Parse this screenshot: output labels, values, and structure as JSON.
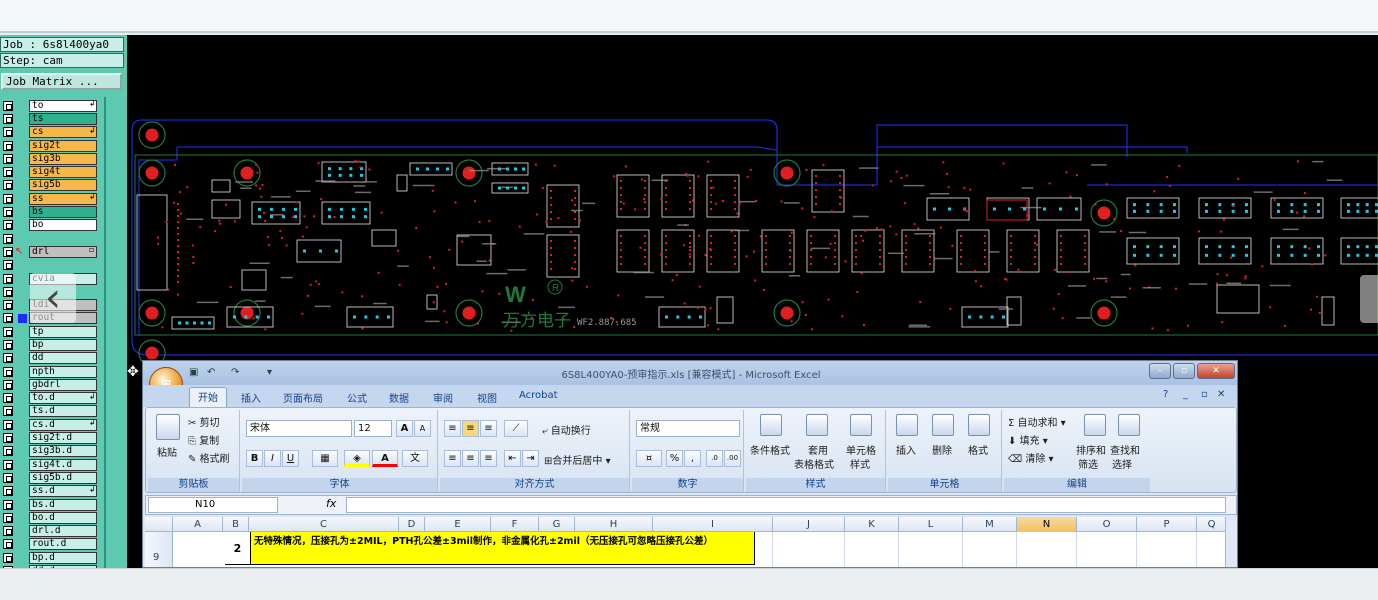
{
  "genesis": {
    "job_line": "Job : 6s8l400ya0",
    "step_line": "Step: cam",
    "job_matrix_btn": "Job Matrix ...",
    "layers": [
      {
        "name": "to",
        "color": "#ffffff",
        "arrow": "↲"
      },
      {
        "name": "ts",
        "color": "#2fb08e",
        "arrow": ""
      },
      {
        "name": "cs",
        "color": "#f6b84a",
        "arrow": "↲"
      },
      {
        "name": "sig2t",
        "color": "#f6b84a",
        "arrow": ""
      },
      {
        "name": "sig3b",
        "color": "#f6b84a",
        "arrow": ""
      },
      {
        "name": "sig4t",
        "color": "#f6b84a",
        "arrow": ""
      },
      {
        "name": "sig5b",
        "color": "#f6b84a",
        "arrow": ""
      },
      {
        "name": "ss",
        "color": "#f6b84a",
        "arrow": "↲"
      },
      {
        "name": "bs",
        "color": "#2fb08e",
        "arrow": ""
      },
      {
        "name": "bo",
        "color": "#ffffff",
        "arrow": ""
      },
      {
        "name": "",
        "color": "#5dc9b1",
        "arrow": ""
      },
      {
        "name": "drl",
        "color": "#bfbfbf",
        "arrow": "▫",
        "active": true
      },
      {
        "name": "",
        "color": "#5dc9b1",
        "arrow": ""
      },
      {
        "name": "cvia",
        "color": "#c8eee8",
        "arrow": ""
      },
      {
        "name": "",
        "color": "#5dc9b1",
        "arrow": ""
      },
      {
        "name": "ldi",
        "color": "#bfbfbf",
        "arrow": ""
      },
      {
        "name": "rout",
        "color": "#bfbfbf",
        "arrow": "",
        "blue": true
      },
      {
        "name": "tp",
        "color": "#c8eee8",
        "arrow": ""
      },
      {
        "name": "bp",
        "color": "#c8eee8",
        "arrow": ""
      },
      {
        "name": "dd",
        "color": "#c8eee8",
        "arrow": ""
      },
      {
        "name": "npth",
        "color": "#c8eee8",
        "arrow": ""
      },
      {
        "name": "gbdrl",
        "color": "#c8eee8",
        "arrow": ""
      },
      {
        "name": "to.d",
        "color": "#c8eee8",
        "arrow": "↲"
      },
      {
        "name": "ts.d",
        "color": "#c8eee8",
        "arrow": ""
      },
      {
        "name": "cs.d",
        "color": "#c8eee8",
        "arrow": "↲"
      },
      {
        "name": "sig2t.d",
        "color": "#c8eee8",
        "arrow": ""
      },
      {
        "name": "sig3b.d",
        "color": "#c8eee8",
        "arrow": ""
      },
      {
        "name": "sig4t.d",
        "color": "#c8eee8",
        "arrow": ""
      },
      {
        "name": "sig5b.d",
        "color": "#c8eee8",
        "arrow": ""
      },
      {
        "name": "ss.d",
        "color": "#c8eee8",
        "arrow": "↲"
      },
      {
        "name": "bs.d",
        "color": "#c8eee8",
        "arrow": ""
      },
      {
        "name": "bo.d",
        "color": "#c8eee8",
        "arrow": ""
      },
      {
        "name": "drl.d",
        "color": "#c8eee8",
        "arrow": ""
      },
      {
        "name": "rout.d",
        "color": "#c8eee8",
        "arrow": ""
      },
      {
        "name": "bp.d",
        "color": "#c8eee8",
        "arrow": ""
      },
      {
        "name": "dd.d",
        "color": "#c8eee8",
        "arrow": ""
      },
      {
        "name": "tp.d",
        "color": "#c8eee8",
        "arrow": ""
      }
    ],
    "pcb": {
      "logo_text": "万方电子",
      "logo_code": "WF2.887.685",
      "logo_letters": "W",
      "registered_mark": "R",
      "outline_color": "#2233ff",
      "trace_color": "#1f7a3a",
      "pad_color": "#e02020",
      "pin_color": "#22c8e0"
    }
  },
  "excel": {
    "title": "6S8L400YA0-预审指示.xls  [兼容模式] - Microsoft Excel",
    "office_button": "⊞",
    "tabs": [
      "开始",
      "插入",
      "页面布局",
      "公式",
      "数据",
      "审阅",
      "视图",
      "Acrobat"
    ],
    "active_tab": "开始",
    "help_icons": [
      "?",
      "_",
      "▫",
      "✕"
    ],
    "groups": {
      "clipboard": {
        "label": "剪贴板",
        "paste": "粘贴",
        "cut": "剪切",
        "copy": "复制",
        "format_painter": "格式刷"
      },
      "font": {
        "label": "字体",
        "font_name": "宋体",
        "font_size": "12",
        "bold": "B",
        "italic": "I",
        "underline": "U",
        "grow": "A",
        "shrink": "A"
      },
      "alignment": {
        "label": "对齐方式",
        "wrap": "自动换行",
        "merge": "合并后居中"
      },
      "number": {
        "label": "数字",
        "format": "常规",
        "percent": "%",
        "comma": ","
      },
      "styles": {
        "label": "样式",
        "cond": "条件格式",
        "table1": "套用",
        "table2": "表格格式",
        "cell1": "单元格",
        "cell2": "样式"
      },
      "cells": {
        "label": "单元格",
        "insert": "插入",
        "delete": "删除",
        "format": "格式"
      },
      "editing": {
        "label": "编辑",
        "autosum": "自动求和",
        "fill": "填充",
        "clear": "清除",
        "sort1": "排序和",
        "sort2": "筛选",
        "find1": "查找和",
        "find2": "选择"
      }
    },
    "name_box": "N10",
    "fx": "fx",
    "columns": [
      "A",
      "B",
      "C",
      "D",
      "E",
      "F",
      "G",
      "H",
      "I",
      "J",
      "K",
      "L",
      "M",
      "N",
      "O",
      "P",
      "Q"
    ],
    "selected_column": "N",
    "row": {
      "number": "9",
      "b": "2",
      "c": "无特殊情况，压接孔为±2MIL，PTH孔公差±3mil制作，非金属化孔±2mil（无压接孔可忽略压接孔公差）"
    }
  }
}
